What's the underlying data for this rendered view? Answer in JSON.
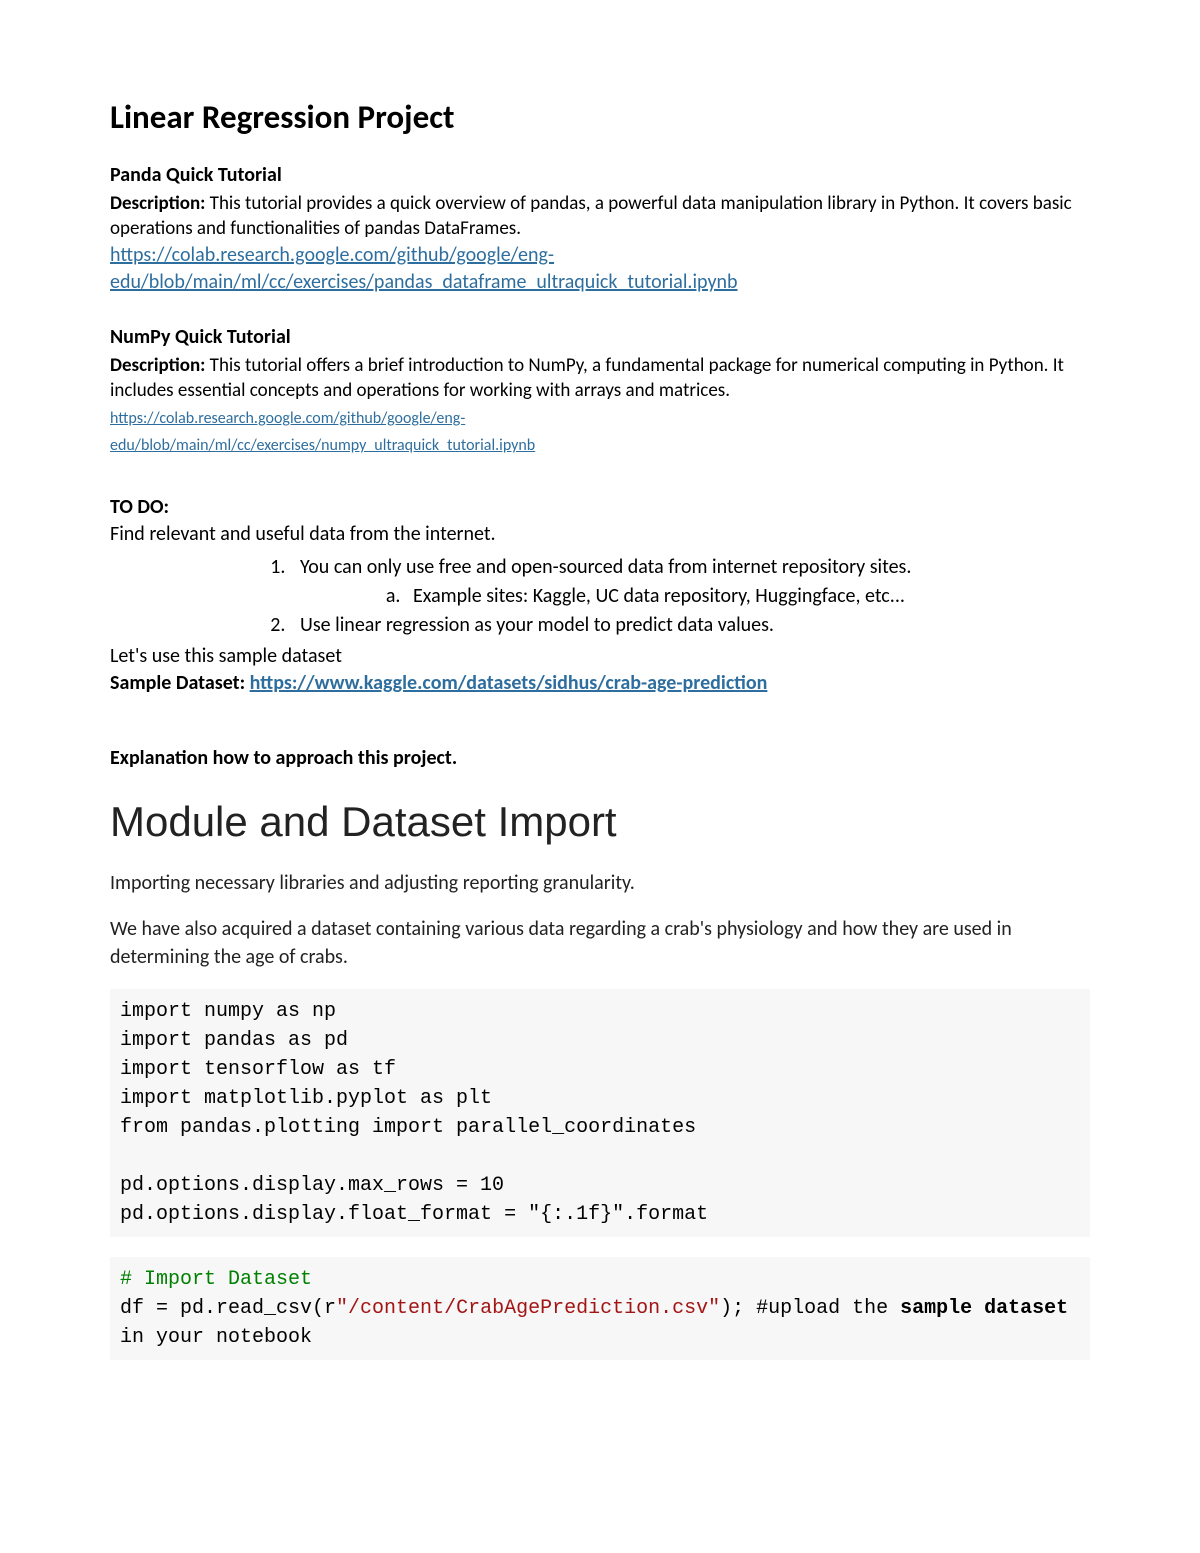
{
  "title": "Linear Regression Project",
  "panda": {
    "heading": "Panda Quick Tutorial",
    "desc_label": "Description:",
    "desc_text": " This tutorial provides a quick overview of pandas, a powerful data manipulation library in Python. It covers basic operations and functionalities of pandas DataFrames.",
    "link_line1": "https://colab.research.google.com/github/google/eng-",
    "link_line2": "edu/blob/main/ml/cc/exercises/pandas_dataframe_ultraquick_tutorial.ipynb"
  },
  "numpy": {
    "heading": "NumPy Quick Tutorial",
    "desc_label": "Description:",
    "desc_text": " This tutorial offers a brief introduction to NumPy, a fundamental package for numerical computing in Python. It includes essential concepts and operations for working with arrays and matrices.",
    "link_line1": "https://colab.research.google.com/github/google/eng-",
    "link_line2": "edu/blob/main/ml/cc/exercises/numpy_ultraquick_tutorial.ipynb"
  },
  "todo": {
    "heading": "TO DO:",
    "intro": "Find relevant and useful data from the internet.",
    "item1": "You can only use free and open-sourced data from internet repository sites.",
    "item1a": "Example sites: Kaggle, UC data repository, Huggingface, etc...",
    "item2": "Use linear regression as your model to predict data values.",
    "use_sample": "Let's use this sample dataset",
    "sample_label": "Sample Dataset: ",
    "sample_link": "https://www.kaggle.com/datasets/sidhus/crab-age-prediction"
  },
  "explain_heading": "Explanation how to approach this project.",
  "module": {
    "title": "Module and Dataset Import",
    "p1": "Importing necessary libraries and adjusting reporting granularity.",
    "p2": "We have also acquired a dataset containing various data regarding a crab's physiology and how they are used in determining the age of crabs."
  },
  "code1": {
    "l1": "import numpy as np",
    "l2": "import pandas as pd",
    "l3": "import tensorflow as tf",
    "l4": "import matplotlib.pyplot as plt",
    "l5": "from pandas.plotting import parallel_coordinates",
    "l6": "",
    "l7": "pd.options.display.max_rows = 10",
    "l8": "pd.options.display.float_format = \"{:.1f}\".format"
  },
  "code2": {
    "comment": "# Import Dataset",
    "pre": "df = pd.read_csv(r",
    "str": "\"/content/CrabAgePrediction.csv\"",
    "post1": "); #upload the ",
    "bold": "sample dataset",
    "post2": " in your notebook"
  }
}
